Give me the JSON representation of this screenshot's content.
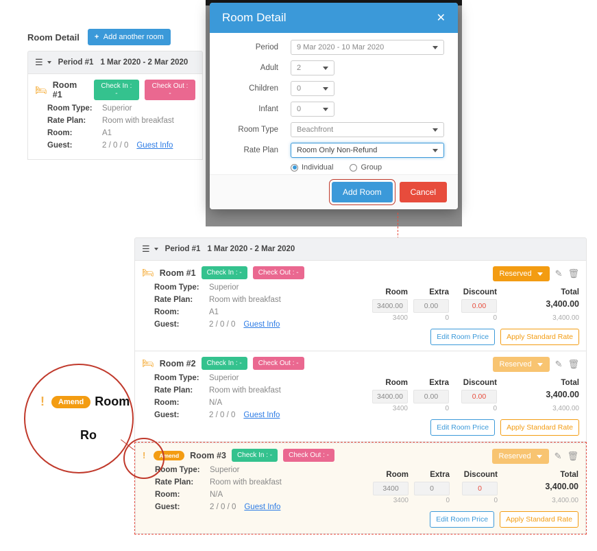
{
  "modal": {
    "title": "Room Detail",
    "fields": {
      "period": {
        "label": "Period",
        "value": "9 Mar 2020 - 10 Mar 2020"
      },
      "adult": {
        "label": "Adult",
        "value": "2"
      },
      "children": {
        "label": "Children",
        "value": "0"
      },
      "infant": {
        "label": "Infant",
        "value": "0"
      },
      "room_type": {
        "label": "Room Type",
        "value": "Beachfront"
      },
      "rate_plan": {
        "label": "Rate Plan",
        "value": "Room Only Non-Refund"
      }
    },
    "booking_type": {
      "individual": "Individual",
      "group": "Group",
      "selected": "individual"
    },
    "buttons": {
      "add": "Add Room",
      "cancel": "Cancel"
    }
  },
  "panel1": {
    "title": "Room Detail",
    "add_another": "Add another room",
    "period_label": "Period #1",
    "period_dates": "1 Mar 2020 - 2 Mar 2020",
    "room": {
      "name": "Room #1",
      "checkin": "Check In : -",
      "checkout": "Check Out : -",
      "room_type_k": "Room Type:",
      "room_type_v": "Superior",
      "rate_plan_k": "Rate Plan:",
      "rate_plan_v": "Room with breakfast",
      "room_k": "Room:",
      "room_v": "A1",
      "guest_k": "Guest:",
      "guest_v": "2 / 0 / 0",
      "guest_info": "Guest Info"
    }
  },
  "panel2": {
    "period_label": "Period #1",
    "period_dates": "1 Mar 2020 - 2 Mar 2020",
    "reserved_label": "Reserved",
    "headers": {
      "room": "Room",
      "extra": "Extra",
      "discount": "Discount",
      "total": "Total"
    },
    "actions": {
      "edit_price": "Edit Room Price",
      "apply_rate": "Apply Standard Rate"
    },
    "common_labels": {
      "checkin": "Check In : -",
      "checkout": "Check Out : -",
      "room_type_k": "Room Type:",
      "rate_plan_k": "Rate Plan:",
      "room_k": "Room:",
      "guest_k": "Guest:",
      "guest_info": "Guest Info",
      "room_type_v": "Superior",
      "rate_plan_v": "Room with breakfast",
      "guest_v": "2 / 0 / 0"
    },
    "rooms": [
      {
        "name": "Room #1",
        "room_v": "A1",
        "room_price": "3400.00",
        "extra": "0.00",
        "discount": "0.00",
        "total": "3,400.00",
        "sub_room": "3400",
        "sub_extra": "0",
        "sub_disc": "0",
        "sub_total": "3,400.00"
      },
      {
        "name": "Room #2",
        "room_v": "N/A",
        "room_price": "3400.00",
        "extra": "0.00",
        "discount": "0.00",
        "total": "3,400.00",
        "sub_room": "3400",
        "sub_extra": "0",
        "sub_disc": "0",
        "sub_total": "3,400.00"
      },
      {
        "name": "Room #3",
        "room_v": "N/A",
        "amend": "Amend",
        "room_price": "3400",
        "extra": "0",
        "discount": "0",
        "total": "3,400.00",
        "sub_room": "3400",
        "sub_extra": "0",
        "sub_disc": "0",
        "sub_total": "3,400.00"
      }
    ]
  },
  "zoom": {
    "amend": "Amend",
    "room_big": "Room",
    "room_small": "Ro"
  }
}
